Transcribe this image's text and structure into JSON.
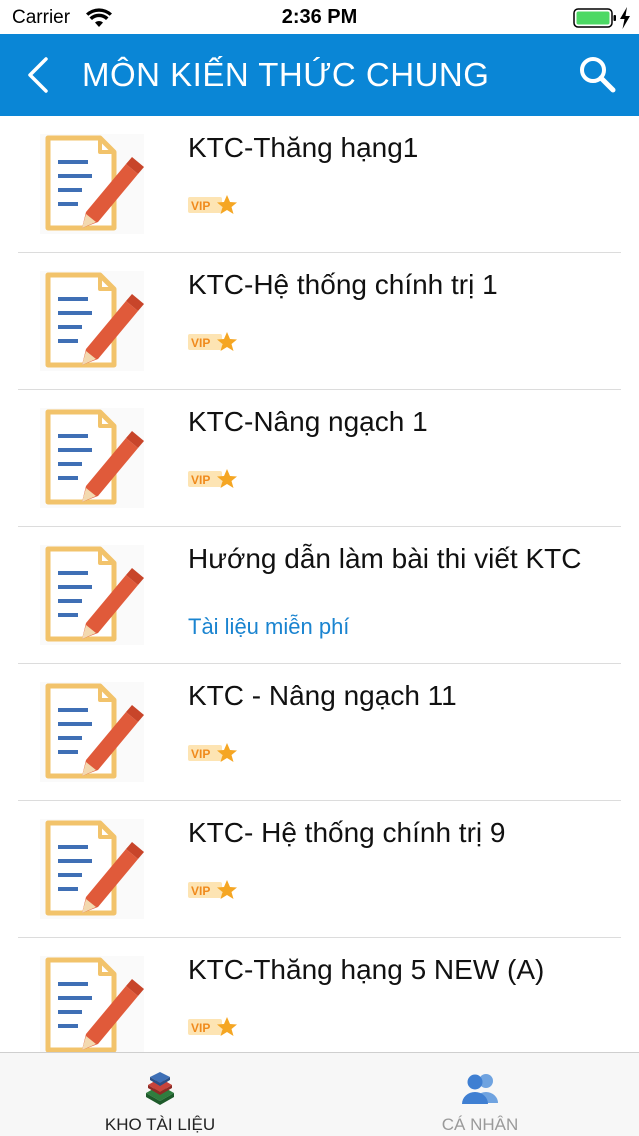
{
  "status": {
    "carrier": "Carrier",
    "time": "2:36 PM"
  },
  "nav": {
    "title": "MÔN KIẾN THỨC CHUNG",
    "back_icon": "chevron-left-icon",
    "search_icon": "search-icon"
  },
  "items": [
    {
      "title": "KTC-Thăng hạng1",
      "badge": "VIP"
    },
    {
      "title": "KTC-Hệ thống chính trị 1",
      "badge": "VIP"
    },
    {
      "title": "KTC-Nâng ngạch 1",
      "badge": "VIP"
    },
    {
      "title": "Hướng dẫn làm bài thi viết KTC",
      "free_label": "Tài liệu miễn phí"
    },
    {
      "title": "KTC - Nâng ngạch 11",
      "badge": "VIP"
    },
    {
      "title": "KTC- Hệ thống chính trị 9",
      "badge": "VIP"
    },
    {
      "title": "KTC-Thăng hạng 5 NEW (A)",
      "badge": "VIP"
    }
  ],
  "tabs": [
    {
      "label": "KHO TÀI LIỆU",
      "icon": "books-icon"
    },
    {
      "label": "CÁ NHÂN",
      "icon": "users-icon"
    }
  ],
  "colors": {
    "nav_bg": "#0a86d6",
    "free_text": "#1a84d0",
    "vip_orange": "#f5a623",
    "doc_frame": "#f2c36b",
    "pencil": "#e05a3a",
    "doc_lines": "#3f6fb5",
    "battery": "#4cd964"
  }
}
